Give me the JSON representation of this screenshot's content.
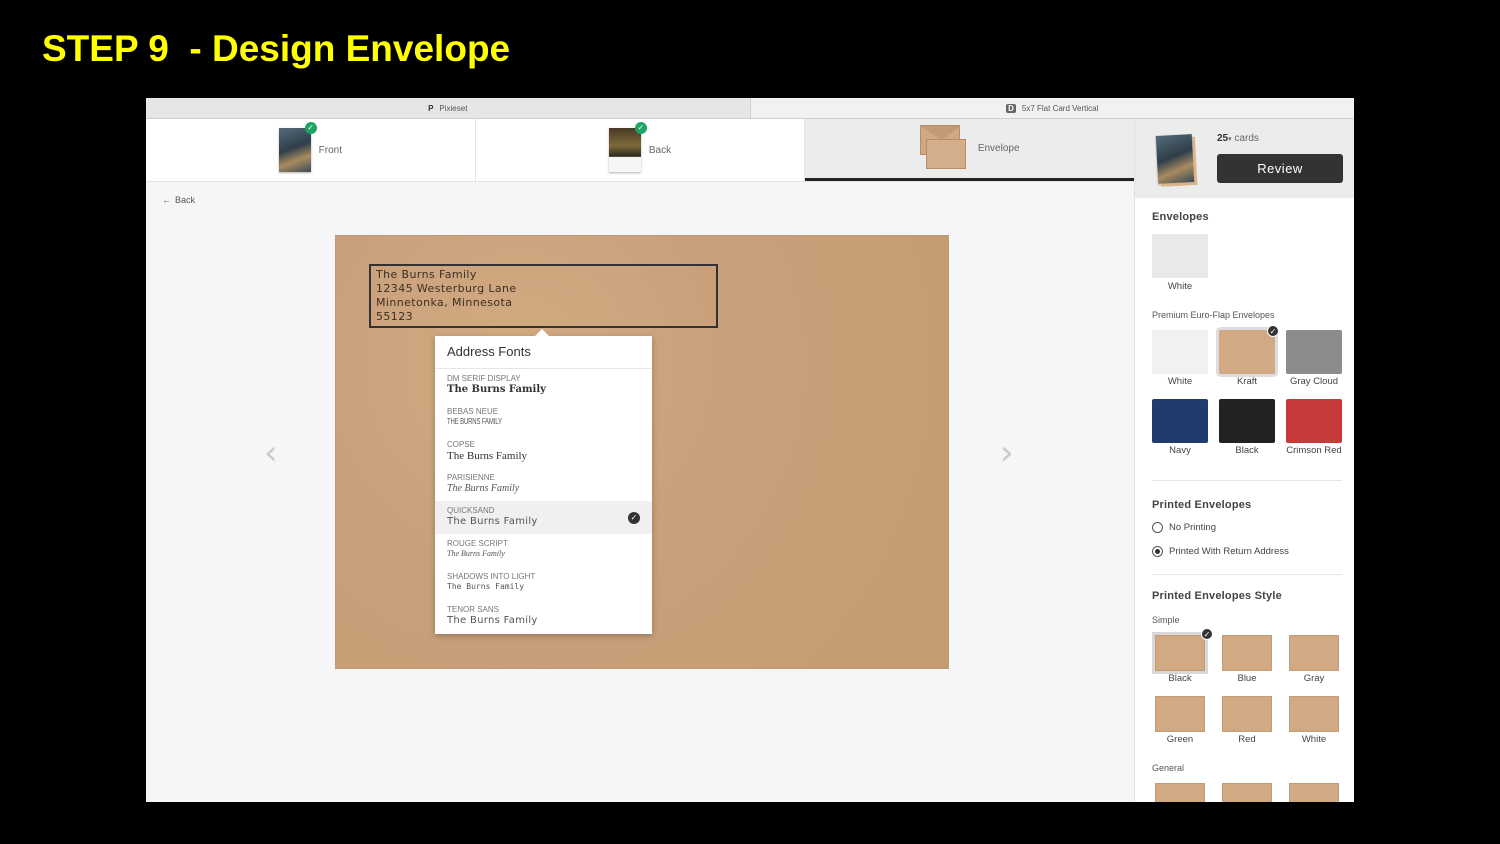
{
  "slide_title": "STEP 9  - Design Envelope",
  "browser_tabs": [
    {
      "favicon": "P",
      "label": "Pixieset"
    },
    {
      "favicon": "D",
      "label": "5x7 Flat Card Vertical"
    }
  ],
  "steps": [
    {
      "label": "Front",
      "completed": true
    },
    {
      "label": "Back",
      "completed": true
    },
    {
      "label": "Envelope",
      "active": true
    }
  ],
  "back_link": "Back",
  "address": {
    "lines": [
      "The Burns Family",
      "12345 Westerburg Lane",
      "Minnetonka, Minnesota",
      "55123"
    ]
  },
  "address_fonts": {
    "title": "Address Fonts",
    "items": [
      {
        "name": "DM SERIF DISPLAY",
        "sample": "The Burns Family"
      },
      {
        "name": "BEBAS NEUE",
        "sample": "THE BURNS FAMILY"
      },
      {
        "name": "COPSE",
        "sample": "The Burns Family"
      },
      {
        "name": "PARISIENNE",
        "sample": "The Burns Family"
      },
      {
        "name": "QUICKSAND",
        "sample": "The Burns Family",
        "selected": true
      },
      {
        "name": "ROUGE SCRIPT",
        "sample": "The Burns Family"
      },
      {
        "name": "SHADOWS INTO LIGHT",
        "sample": "The Burns Family"
      },
      {
        "name": "TENOR SANS",
        "sample": "The Burns Family"
      }
    ]
  },
  "sidebar": {
    "quantity": "25",
    "quantity_unit": "cards",
    "review_label": "Review",
    "envelopes_title": "Envelopes",
    "basic": [
      {
        "label": "White",
        "color": "#e9e9ec"
      }
    ],
    "premium_title": "Premium Euro-Flap Envelopes",
    "premium": [
      {
        "label": "White",
        "color": "#f1f1f3"
      },
      {
        "label": "Kraft",
        "color": "#d1a983",
        "selected": true
      },
      {
        "label": "Gray Cloud",
        "color": "#8c8c8c"
      },
      {
        "label": "Navy",
        "color": "#1f3c6c"
      },
      {
        "label": "Black",
        "color": "#222222"
      },
      {
        "label": "Crimson Red",
        "color": "#c73a3a"
      }
    ],
    "printed_title": "Printed Envelopes",
    "printed_options": [
      {
        "label": "No Printing",
        "selected": false
      },
      {
        "label": "Printed With Return Address",
        "selected": true
      }
    ],
    "style_title": "Printed Envelopes Style",
    "simple_title": "Simple",
    "simple_styles": [
      {
        "label": "Black",
        "selected": true
      },
      {
        "label": "Blue"
      },
      {
        "label": "Gray"
      },
      {
        "label": "Green"
      },
      {
        "label": "Red"
      },
      {
        "label": "White"
      }
    ],
    "general_title": "General"
  }
}
